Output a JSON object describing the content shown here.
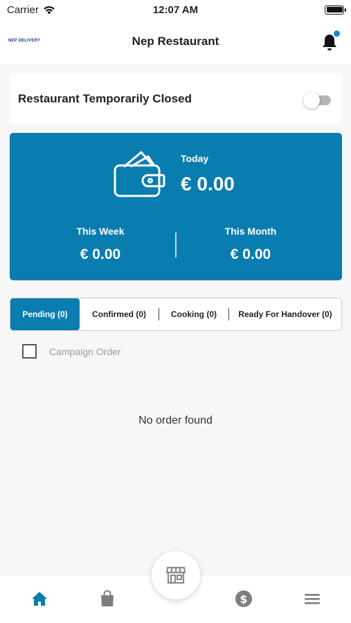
{
  "status_bar": {
    "carrier": "Carrier",
    "time": "12:07 AM"
  },
  "header": {
    "brand": "NEP DELIVERY",
    "title": "Nep Restaurant"
  },
  "closed_toggle": {
    "label": "Restaurant Temporarily Closed",
    "on": false
  },
  "earnings": {
    "today_label": "Today",
    "today_value": "€ 0.00",
    "week_label": "This Week",
    "week_value": "€ 0.00",
    "month_label": "This Month",
    "month_value": "€ 0.00"
  },
  "tabs": [
    {
      "label": "Pending (0)",
      "active": true
    },
    {
      "label": "Confirmed (0)",
      "active": false
    },
    {
      "label": "Cooking (0)",
      "active": false
    },
    {
      "label": "Ready For Handover (0)",
      "active": false
    }
  ],
  "campaign": {
    "label": "Campaign Order",
    "checked": false
  },
  "empty_state": "No order found",
  "bottom_nav": {
    "items": [
      "home-icon",
      "shopping-bag-icon",
      "store-icon",
      "dollar-icon",
      "menu-icon"
    ],
    "active": "home-icon"
  },
  "colors": {
    "accent": "#0a7db0",
    "notification_dot": "#1a85c4"
  }
}
